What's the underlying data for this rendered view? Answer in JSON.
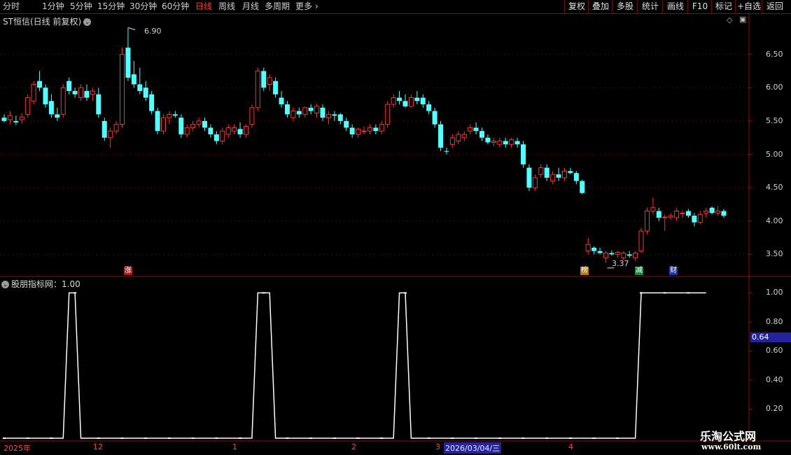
{
  "toolbar": {
    "periods": [
      "分时",
      "1分钟",
      "5分钟",
      "15分钟",
      "30分钟",
      "60分钟",
      "日线",
      "周线",
      "月线",
      "多周期",
      "更多"
    ],
    "active_period": "日线",
    "right_buttons": [
      "复权",
      "叠加",
      "多股",
      "统计",
      "画线",
      "F10",
      "标记",
      "+自选",
      "返回"
    ]
  },
  "main_panel": {
    "title": "ST恒信(日线 前复权)",
    "high_label": "6.90",
    "low_label": "3.37",
    "markers": [
      "涨",
      "榜",
      "减",
      "财"
    ]
  },
  "indicator_panel": {
    "title": "股朋指标网：1.00",
    "current_value_label": "0.64"
  },
  "x_axis": {
    "labels": [
      "2025年",
      "12",
      "1",
      "2",
      "3",
      "4"
    ],
    "cursor_date": "2026/03/04/三"
  },
  "watermark": {
    "line1": "乐淘公式网",
    "line2": "www.60lt.com"
  },
  "colors": {
    "up": "#ff3232",
    "down": "#54ffff",
    "grid": "#8a1010",
    "indicator": "#ffffff",
    "highlight": "#2424a0"
  },
  "chart_data": [
    {
      "type": "candlestick",
      "title": "ST恒信(日线 前复权)",
      "y_ticks": [
        3.5,
        4.0,
        4.5,
        5.0,
        5.5,
        6.0,
        6.5
      ],
      "ylim": [
        3.2,
        7.0
      ],
      "candles": [
        [
          5.55,
          5.6,
          5.48,
          5.5
        ],
        [
          5.52,
          5.65,
          5.45,
          5.58
        ],
        [
          5.5,
          5.58,
          5.44,
          5.48
        ],
        [
          5.52,
          5.62,
          5.46,
          5.56
        ],
        [
          5.6,
          5.9,
          5.55,
          5.85
        ],
        [
          5.8,
          6.1,
          5.75,
          6.05
        ],
        [
          6.1,
          6.25,
          5.95,
          6.0
        ],
        [
          6.0,
          6.05,
          5.7,
          5.75
        ],
        [
          5.8,
          5.9,
          5.55,
          5.6
        ],
        [
          5.6,
          5.7,
          5.5,
          5.55
        ],
        [
          5.6,
          6.05,
          5.55,
          6.0
        ],
        [
          6.1,
          6.15,
          5.9,
          5.95
        ],
        [
          5.95,
          6.0,
          5.85,
          5.9
        ],
        [
          5.85,
          6.05,
          5.8,
          6.0
        ],
        [
          5.95,
          6.05,
          5.8,
          5.85
        ],
        [
          5.9,
          6.0,
          5.8,
          5.95
        ],
        [
          5.9,
          6.0,
          5.55,
          5.6
        ],
        [
          5.5,
          5.55,
          5.2,
          5.25
        ],
        [
          5.25,
          5.4,
          5.1,
          5.35
        ],
        [
          5.35,
          5.5,
          5.3,
          5.45
        ],
        [
          5.45,
          6.6,
          5.4,
          6.5
        ],
        [
          6.6,
          6.9,
          6.1,
          6.15
        ],
        [
          6.2,
          6.4,
          6.0,
          6.05
        ],
        [
          6.05,
          6.3,
          5.9,
          5.95
        ],
        [
          6.0,
          6.1,
          5.8,
          5.85
        ],
        [
          5.9,
          5.95,
          5.6,
          5.65
        ],
        [
          5.65,
          5.7,
          5.3,
          5.35
        ],
        [
          5.35,
          5.6,
          5.3,
          5.55
        ],
        [
          5.55,
          5.65,
          5.45,
          5.6
        ],
        [
          5.6,
          5.65,
          5.55,
          5.58
        ],
        [
          5.55,
          5.6,
          5.25,
          5.3
        ],
        [
          5.3,
          5.45,
          5.25,
          5.4
        ],
        [
          5.4,
          5.5,
          5.35,
          5.45
        ],
        [
          5.45,
          5.55,
          5.4,
          5.5
        ],
        [
          5.5,
          5.55,
          5.35,
          5.4
        ],
        [
          5.4,
          5.45,
          5.25,
          5.3
        ],
        [
          5.3,
          5.35,
          5.15,
          5.2
        ],
        [
          5.2,
          5.4,
          5.15,
          5.35
        ],
        [
          5.3,
          5.45,
          5.25,
          5.4
        ],
        [
          5.35,
          5.45,
          5.3,
          5.4
        ],
        [
          5.38,
          5.48,
          5.25,
          5.3
        ],
        [
          5.3,
          5.45,
          5.25,
          5.42
        ],
        [
          5.45,
          5.75,
          5.4,
          5.7
        ],
        [
          5.7,
          6.3,
          5.65,
          6.25
        ],
        [
          6.25,
          6.3,
          5.95,
          6.0
        ],
        [
          6.05,
          6.2,
          5.95,
          6.15
        ],
        [
          6.1,
          6.15,
          5.85,
          5.9
        ],
        [
          5.85,
          5.95,
          5.7,
          5.75
        ],
        [
          5.75,
          5.8,
          5.55,
          5.6
        ],
        [
          5.55,
          5.7,
          5.5,
          5.65
        ],
        [
          5.65,
          5.7,
          5.55,
          5.6
        ],
        [
          5.6,
          5.72,
          5.55,
          5.7
        ],
        [
          5.7,
          5.75,
          5.6,
          5.65
        ],
        [
          5.62,
          5.76,
          5.55,
          5.72
        ],
        [
          5.7,
          5.75,
          5.5,
          5.55
        ],
        [
          5.55,
          5.65,
          5.45,
          5.6
        ],
        [
          5.6,
          5.65,
          5.5,
          5.58
        ],
        [
          5.6,
          5.62,
          5.45,
          5.5
        ],
        [
          5.5,
          5.55,
          5.35,
          5.4
        ],
        [
          5.4,
          5.45,
          5.25,
          5.3
        ],
        [
          5.3,
          5.4,
          5.25,
          5.38
        ],
        [
          5.35,
          5.42,
          5.3,
          5.35
        ],
        [
          5.35,
          5.45,
          5.3,
          5.4
        ],
        [
          5.4,
          5.45,
          5.3,
          5.35
        ],
        [
          5.35,
          5.5,
          5.3,
          5.45
        ],
        [
          5.45,
          5.8,
          5.4,
          5.75
        ],
        [
          5.75,
          5.9,
          5.7,
          5.85
        ],
        [
          5.85,
          5.95,
          5.75,
          5.8
        ],
        [
          5.8,
          5.9,
          5.7,
          5.72
        ],
        [
          5.72,
          5.9,
          5.7,
          5.85
        ],
        [
          5.85,
          5.95,
          5.75,
          5.8
        ],
        [
          5.85,
          5.9,
          5.7,
          5.75
        ],
        [
          5.75,
          5.8,
          5.6,
          5.65
        ],
        [
          5.65,
          5.7,
          5.4,
          5.45
        ],
        [
          5.45,
          5.5,
          5.05,
          5.1
        ],
        [
          5.05,
          5.1,
          5.0,
          5.04
        ],
        [
          5.15,
          5.3,
          5.1,
          5.25
        ],
        [
          5.2,
          5.35,
          5.15,
          5.3
        ],
        [
          5.25,
          5.35,
          5.2,
          5.3
        ],
        [
          5.35,
          5.45,
          5.3,
          5.4
        ],
        [
          5.4,
          5.48,
          5.3,
          5.35
        ],
        [
          5.35,
          5.4,
          5.2,
          5.25
        ],
        [
          5.25,
          5.3,
          5.15,
          5.18
        ],
        [
          5.18,
          5.25,
          5.12,
          5.2
        ],
        [
          5.15,
          5.25,
          5.1,
          5.2
        ],
        [
          5.2,
          5.25,
          5.1,
          5.15
        ],
        [
          5.15,
          5.25,
          5.1,
          5.22
        ],
        [
          5.2,
          5.25,
          5.1,
          5.15
        ],
        [
          5.15,
          5.2,
          4.8,
          4.85
        ],
        [
          4.8,
          4.85,
          4.45,
          4.5
        ],
        [
          4.5,
          4.7,
          4.45,
          4.65
        ],
        [
          4.7,
          4.85,
          4.65,
          4.8
        ],
        [
          4.8,
          4.85,
          4.6,
          4.65
        ],
        [
          4.6,
          4.75,
          4.55,
          4.7
        ],
        [
          4.7,
          4.8,
          4.6,
          4.65
        ],
        [
          4.65,
          4.8,
          4.6,
          4.75
        ],
        [
          4.75,
          4.8,
          4.7,
          4.72
        ],
        [
          4.72,
          4.75,
          4.55,
          4.6
        ],
        [
          4.6,
          4.62,
          4.4,
          4.42
        ],
        [
          3.55,
          3.75,
          3.5,
          3.65
        ],
        [
          3.6,
          3.62,
          3.5,
          3.55
        ],
        [
          3.55,
          3.6,
          3.5,
          3.52
        ],
        [
          3.45,
          3.55,
          3.37,
          3.52
        ],
        [
          3.52,
          3.56,
          3.48,
          3.5
        ],
        [
          3.5,
          3.55,
          3.45,
          3.53
        ],
        [
          3.45,
          3.55,
          3.42,
          3.52
        ],
        [
          3.5,
          3.55,
          3.45,
          3.48
        ],
        [
          3.45,
          3.55,
          3.4,
          3.52
        ],
        [
          3.55,
          3.9,
          3.52,
          3.85
        ],
        [
          3.85,
          4.2,
          3.8,
          4.15
        ],
        [
          4.15,
          4.35,
          4.1,
          4.2
        ],
        [
          4.15,
          4.2,
          4.0,
          4.05
        ],
        [
          4.05,
          4.1,
          3.85,
          4.06
        ],
        [
          4.06,
          4.12,
          4.02,
          4.08
        ],
        [
          4.05,
          4.2,
          4.0,
          4.15
        ],
        [
          4.12,
          4.16,
          4.05,
          4.12
        ],
        [
          4.15,
          4.18,
          4.05,
          4.08
        ],
        [
          4.08,
          4.12,
          3.92,
          3.98
        ],
        [
          3.98,
          4.15,
          3.95,
          4.1
        ],
        [
          4.12,
          4.2,
          4.05,
          4.15
        ],
        [
          4.2,
          4.22,
          4.1,
          4.12
        ],
        [
          4.12,
          4.22,
          4.08,
          4.15
        ],
        [
          4.15,
          4.18,
          4.05,
          4.08
        ]
      ]
    },
    {
      "type": "line",
      "title": "股朋指标网",
      "y_ticks": [
        0.2,
        0.4,
        0.6,
        0.8,
        1.0
      ],
      "ylim": [
        0,
        1.05
      ],
      "values": [
        0,
        0,
        0,
        0,
        0,
        0,
        0,
        0,
        0,
        0,
        0,
        1,
        1,
        0,
        0,
        0,
        0,
        0,
        0,
        0,
        0,
        0,
        0,
        0,
        0,
        0,
        0,
        0,
        0,
        0,
        0,
        0,
        0,
        0,
        0,
        0,
        0,
        0,
        0,
        0,
        0,
        0,
        0,
        1,
        1,
        1,
        0,
        0,
        0,
        0,
        0,
        0,
        0,
        0,
        0,
        0,
        0,
        0,
        0,
        0,
        0,
        0,
        0,
        0,
        0,
        0,
        0,
        1,
        1,
        0,
        0,
        0,
        0,
        0,
        0,
        0,
        0,
        0,
        0,
        0,
        0,
        0,
        0,
        0,
        0,
        0,
        0,
        0,
        0,
        0,
        0,
        0,
        0,
        0,
        0,
        0,
        0,
        0,
        0,
        0,
        0,
        0,
        0,
        0,
        0,
        0,
        0,
        0,
        1,
        1,
        1,
        1,
        1,
        1,
        1,
        1,
        1,
        1,
        1,
        1
      ]
    }
  ]
}
